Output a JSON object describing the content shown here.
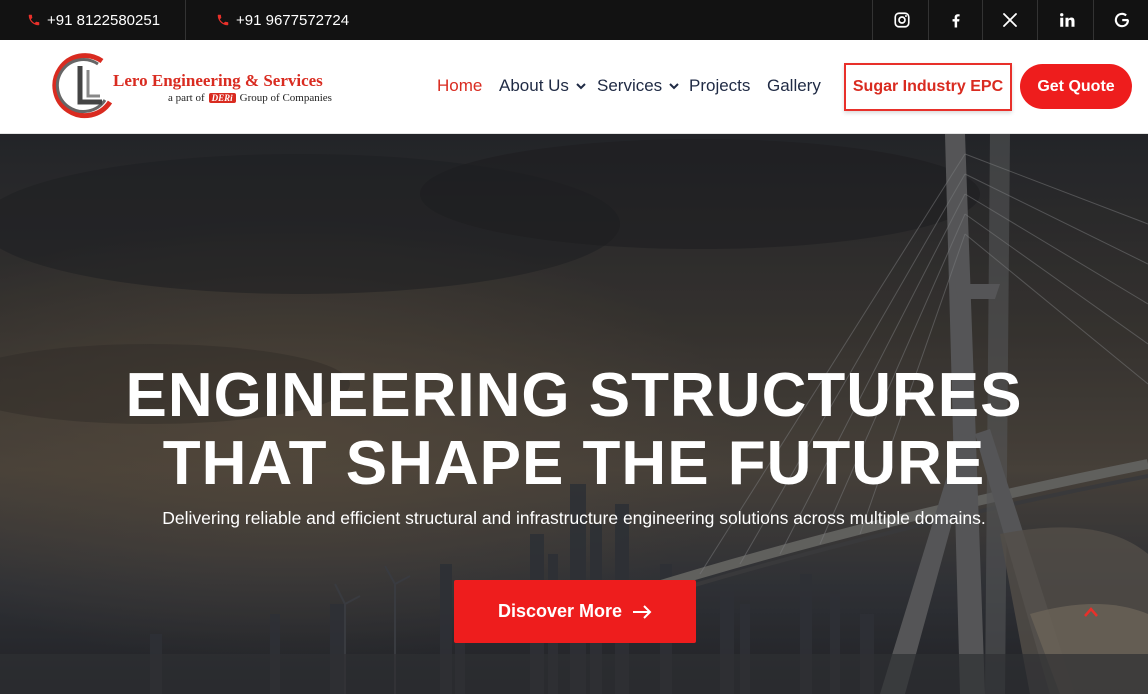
{
  "topbar": {
    "phone1": "+91 8122580251",
    "phone2": "+91 9677572724",
    "social": [
      "instagram-icon",
      "facebook-icon",
      "x-icon",
      "linkedin-icon",
      "google-icon"
    ]
  },
  "logo": {
    "title": "Lero Engineering & Services",
    "sub_prefix": "a part of",
    "sub_brand": "DERi",
    "sub_suffix": "Group of Companies"
  },
  "nav": {
    "home": "Home",
    "about": "About Us",
    "services": "Services",
    "projects": "Projects",
    "gallery": "Gallery",
    "epc_button": "Sugar Industry EPC",
    "quote_button": "Get Quote"
  },
  "hero": {
    "title_line1": "ENGINEERING STRUCTURES",
    "title_line2": "THAT SHAPE THE FUTURE",
    "subtitle": "Delivering reliable and efficient structural and infrastructure engineering solutions across multiple domains.",
    "cta": "Discover More"
  },
  "colors": {
    "accent": "#ee1d1d",
    "topbar": "#121212",
    "nav_text": "#1f2a44"
  }
}
